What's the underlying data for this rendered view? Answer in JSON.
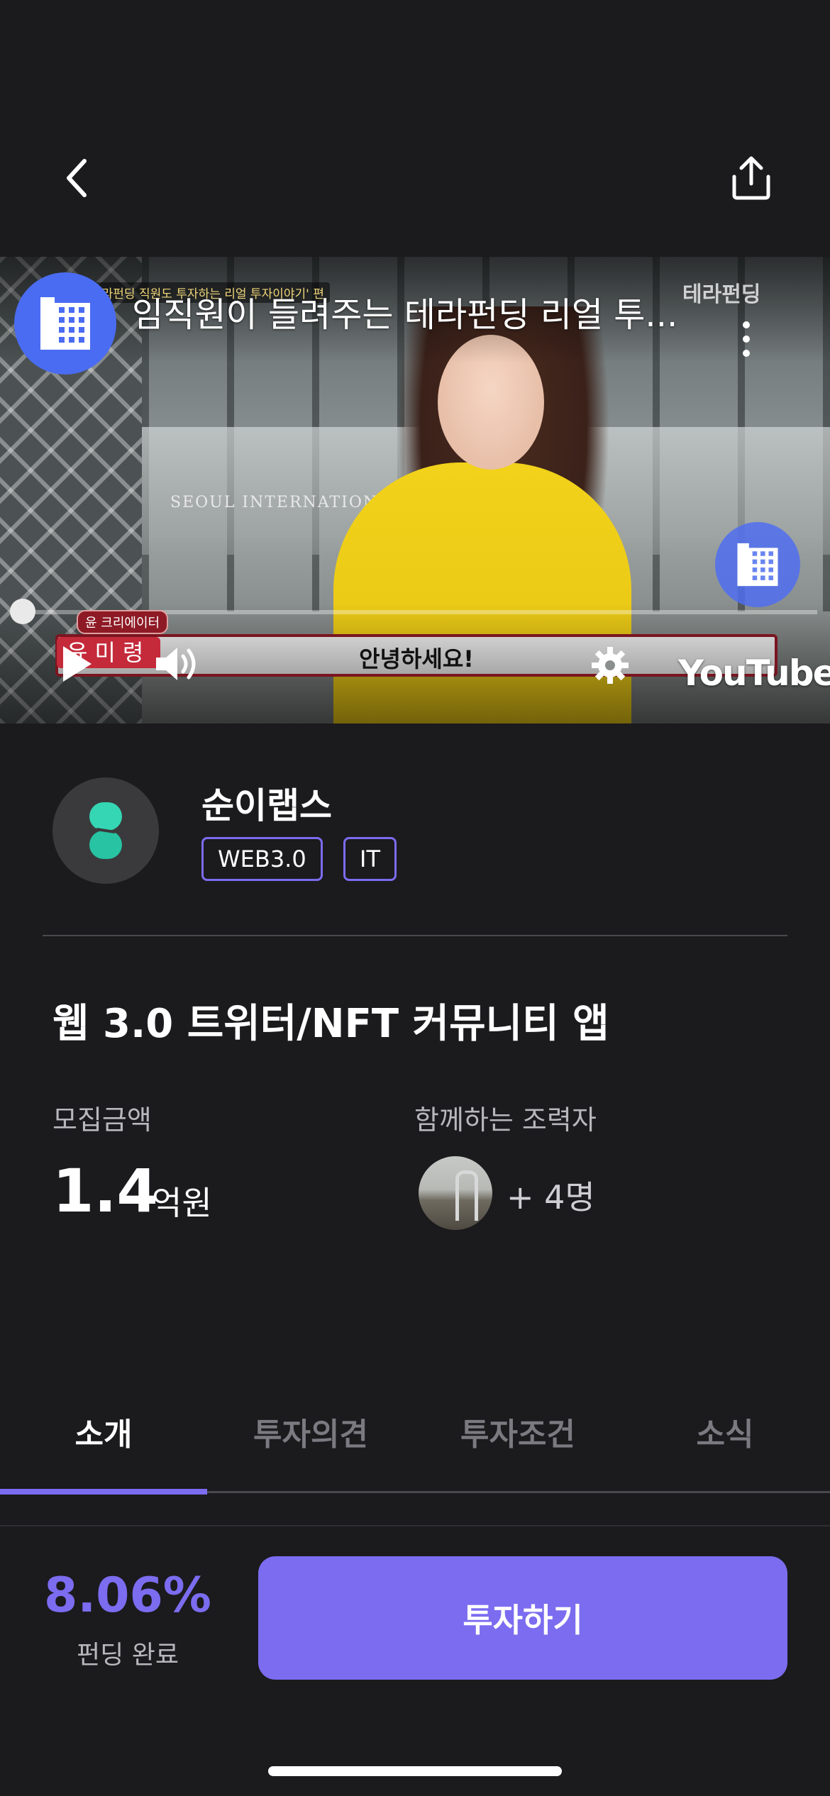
{
  "video": {
    "title": "임직원이 들려주는 테라펀딩 리얼 투...",
    "episode_tag": "테라펀딩 직원도 투자하는 리얼 투자이야기' 편",
    "brand_mark": "테라펀딩",
    "sign_text": "SEOUL INTERNATIONAL",
    "subtitle": "안녕하세요!",
    "speaker_name": "윤미령",
    "speaker_role": "윤 크리에이터",
    "platform": "YouTube"
  },
  "company": {
    "name": "순이랩스",
    "tags": [
      "WEB3.0",
      "IT"
    ]
  },
  "project": {
    "title": "웹 3.0 트위터/NFT 커뮤니티 앱"
  },
  "stats": {
    "amount_label": "모집금액",
    "amount_value": "1.4",
    "amount_unit": "억원",
    "supporters_label": "함께하는 조력자",
    "supporters_count": "+ 4명"
  },
  "tabs": [
    {
      "label": "소개",
      "active": true
    },
    {
      "label": "투자의견",
      "active": false
    },
    {
      "label": "투자조건",
      "active": false
    },
    {
      "label": "소식",
      "active": false
    }
  ],
  "funding": {
    "percent": "8.06%",
    "label": "펀딩 완료",
    "invest_button": "투자하기"
  },
  "colors": {
    "accent": "#7b6cf0",
    "background": "#1b1a1d",
    "channel_blue": "#4a6cf2"
  }
}
